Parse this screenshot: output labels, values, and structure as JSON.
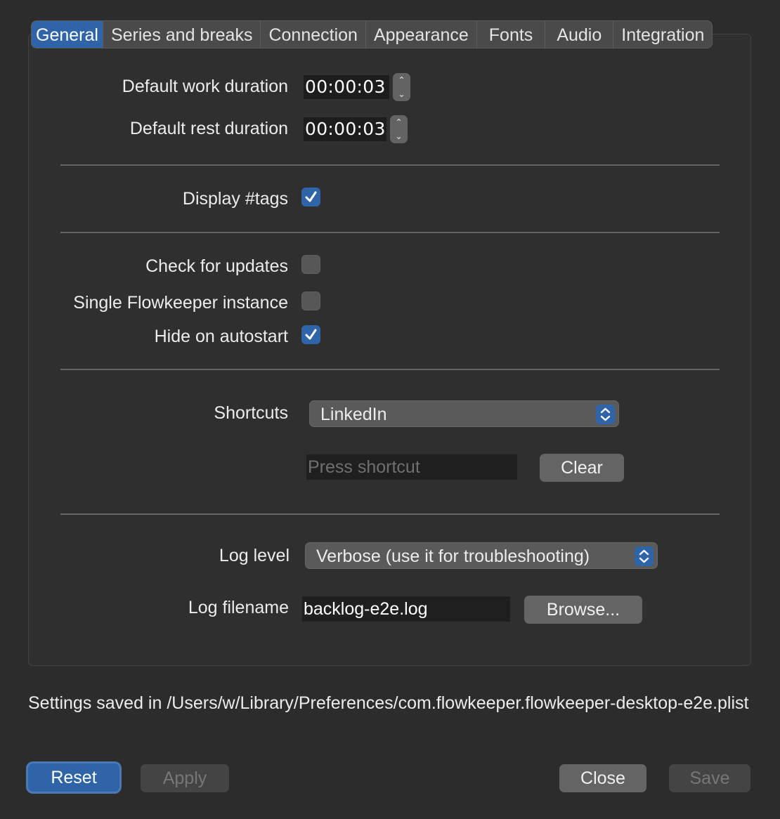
{
  "tabs": [
    "General",
    "Series and breaks",
    "Connection",
    "Appearance",
    "Fonts",
    "Audio",
    "Integration"
  ],
  "general": {
    "work_duration_label": "Default work duration",
    "work_duration_value": "00:00:03",
    "rest_duration_label": "Default rest duration",
    "rest_duration_value": "00:00:03",
    "display_tags_label": "Display #tags",
    "display_tags_checked": true,
    "check_updates_label": "Check for updates",
    "check_updates_checked": false,
    "single_instance_label": "Single Flowkeeper instance",
    "single_instance_checked": false,
    "hide_autostart_label": "Hide on autostart",
    "hide_autostart_checked": true,
    "shortcuts_label": "Shortcuts",
    "shortcuts_selected": "LinkedIn",
    "shortcut_placeholder": "Press shortcut",
    "clear_label": "Clear",
    "log_level_label": "Log level",
    "log_level_selected": "Verbose (use it for troubleshooting)",
    "log_filename_label": "Log filename",
    "log_filename_value": "backlog-e2e.log",
    "browse_label": "Browse..."
  },
  "footer": {
    "settings_path_text": "Settings saved in /Users/w/Library/Preferences/com.flowkeeper.flowkeeper-desktop-e2e.plist",
    "reset_label": "Reset",
    "apply_label": "Apply",
    "close_label": "Close",
    "save_label": "Save"
  },
  "colors": {
    "accent": "#2f65a8",
    "background": "#2c2c2c"
  }
}
